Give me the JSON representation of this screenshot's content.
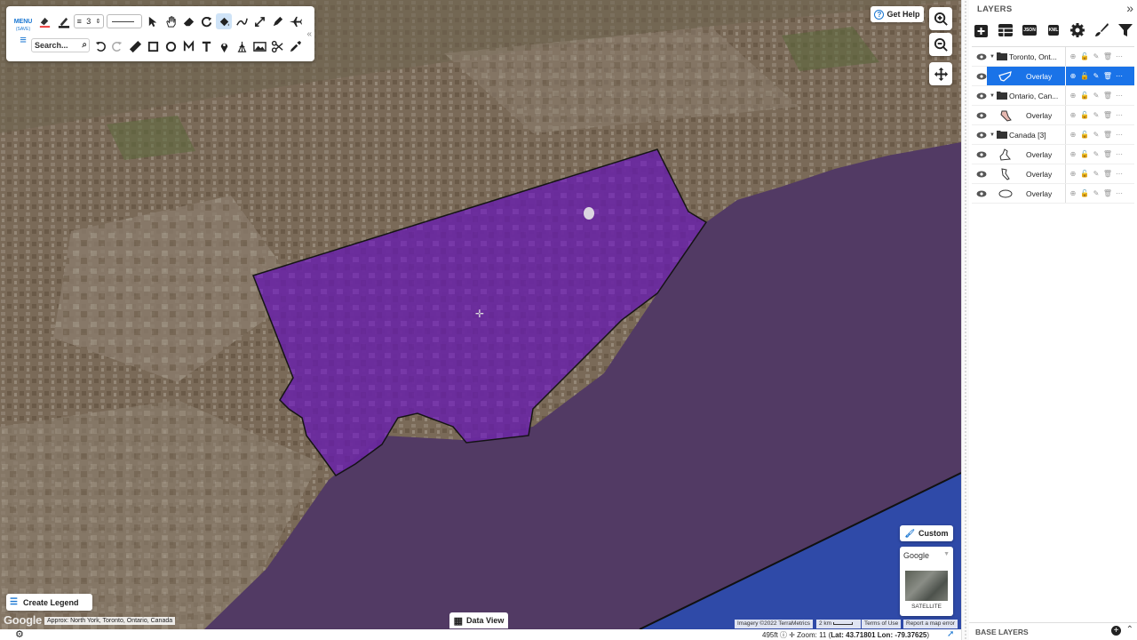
{
  "toolbar": {
    "menu_label": "MENU",
    "menu_sub": "(SAVE)",
    "line_width": "3",
    "search_placeholder": "Search..."
  },
  "map": {
    "get_help": "Get Help",
    "create_legend": "Create Legend",
    "google_logo": "Google",
    "approx_location": "Approx: North York, Toronto, Ontario, Canada",
    "data_view": "Data View",
    "attribution": {
      "imagery": "Imagery ©2022 TerraMetrics",
      "scale": "2 km",
      "terms": "Terms of Use",
      "report": "Report a map error"
    },
    "basemap": {
      "custom_label": "Custom",
      "provider": "Google",
      "thumb_label": "SATELLITE"
    },
    "polygon_fill": "#7b2fb8",
    "water_color": "#4e3460"
  },
  "status": {
    "elevation": "495ft",
    "zoom": "Zoom: 11",
    "lat_label": "Lat:",
    "lat": "43.71801",
    "lon_label": "Lon:",
    "lon": "-79.37625"
  },
  "sidebar": {
    "title": "LAYERS",
    "tools": [
      "add-icon",
      "table-icon",
      "json-icon",
      "kml-icon",
      "gear-icon",
      "brush-icon",
      "filter-icon"
    ],
    "json_label": "JSON",
    "kml_label": "KML",
    "layers": [
      {
        "type": "folder",
        "name": "Toronto, Ont..."
      },
      {
        "type": "overlay",
        "name": "Overlay",
        "selected": true
      },
      {
        "type": "folder",
        "name": "Ontario, Can..."
      },
      {
        "type": "overlay",
        "name": "Overlay"
      },
      {
        "type": "folder",
        "name": "Canada [3]"
      },
      {
        "type": "overlay",
        "name": "Overlay"
      },
      {
        "type": "overlay",
        "name": "Overlay"
      },
      {
        "type": "overlay",
        "name": "Overlay"
      }
    ],
    "footer": "BASE LAYERS"
  }
}
